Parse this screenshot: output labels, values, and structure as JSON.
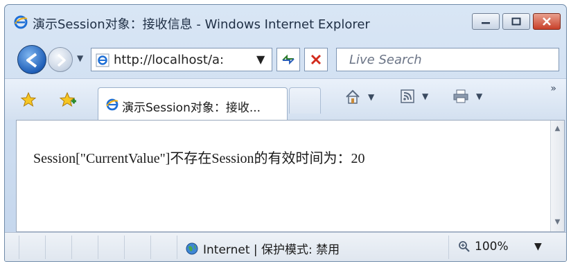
{
  "window": {
    "title": "演示Session对象：接收信息 - Windows Internet Explorer"
  },
  "address": {
    "url": "http://localhost/a:"
  },
  "search": {
    "placeholder": "Live Search"
  },
  "tab": {
    "label": "演示Session对象：接收..."
  },
  "content": {
    "text": "Session[\"CurrentValue\"]不存在Session的有效时间为：20"
  },
  "status": {
    "zone": "Internet | 保护模式: 禁用",
    "zoom": "100%"
  },
  "icons": [
    "ie-icon",
    "back-icon",
    "forward-icon",
    "refresh-icon",
    "stop-icon",
    "favorites-star-icon",
    "add-favorites-icon",
    "home-icon",
    "feeds-icon",
    "print-icon",
    "globe-icon",
    "zoom-icon"
  ],
  "colors": {
    "chrome": "#c3d5ec",
    "close_button": "#c8402a",
    "back_button": "#1f5fb8"
  }
}
